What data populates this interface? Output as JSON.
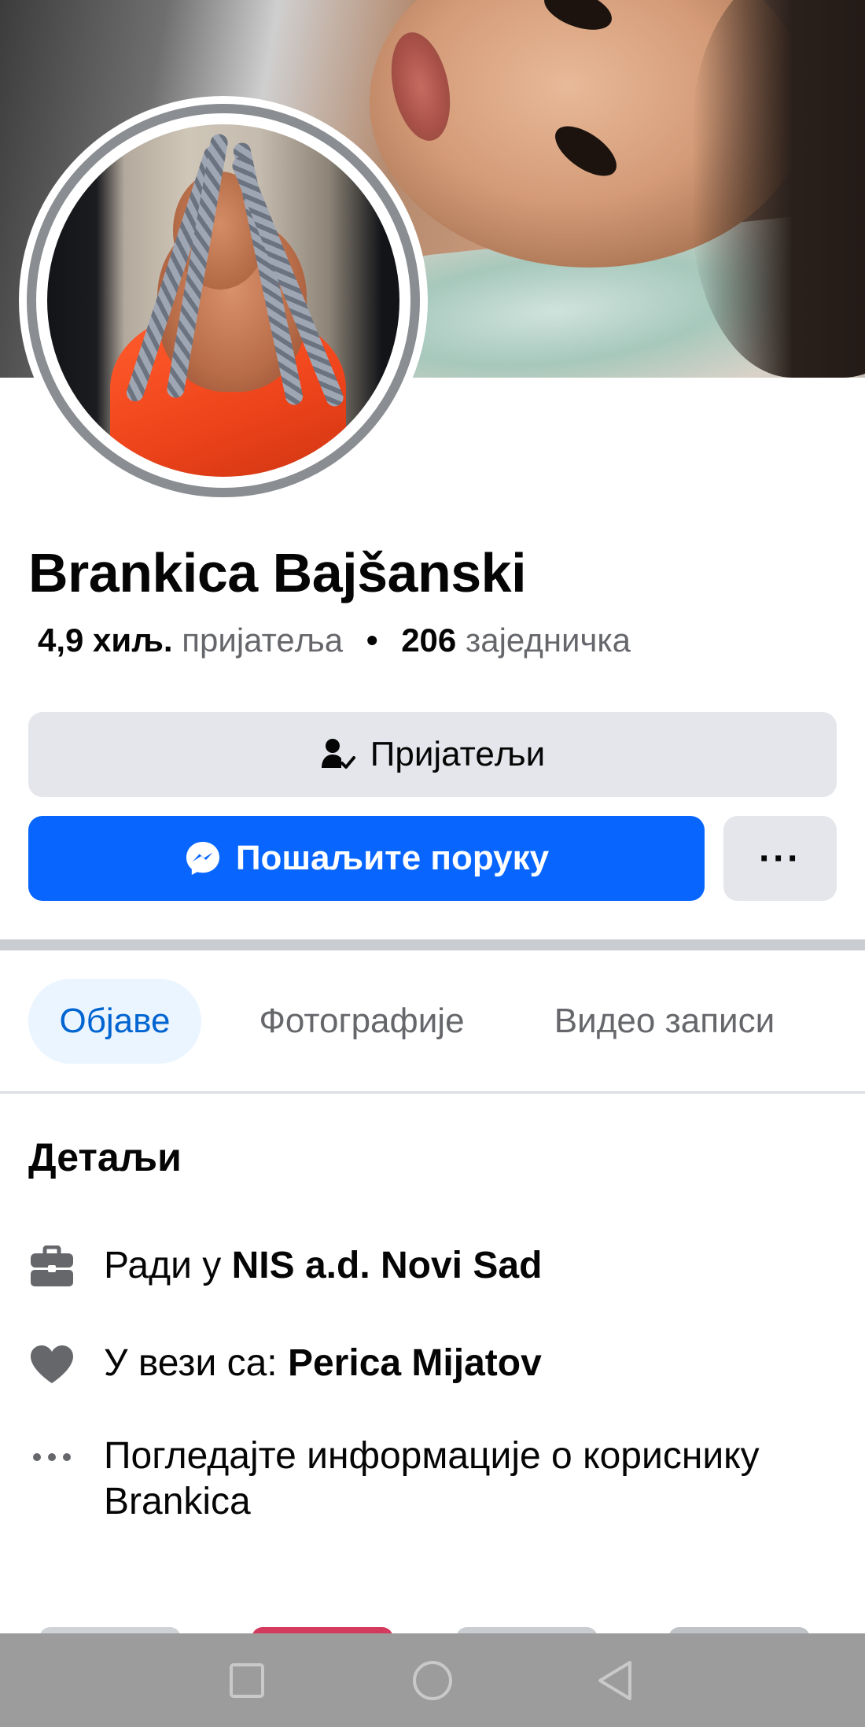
{
  "profile": {
    "name": "Brankica Bajšanski",
    "friends_count": "4,9 хиљ.",
    "friends_label": "пријатеља",
    "separator": "•",
    "mutual_count": "206",
    "mutual_label": "заједничка"
  },
  "actions": {
    "friends_label": "Пријатељи",
    "message_label": "Пошаљите поруку",
    "more_label": "···"
  },
  "tabs": [
    {
      "label": "Објаве",
      "active": true
    },
    {
      "label": "Фотографије",
      "active": false
    },
    {
      "label": "Видео записи",
      "active": false
    }
  ],
  "details": {
    "title": "Детаљи",
    "work_prefix": "Ради у",
    "work_place": "NIS a.d. Novi Sad",
    "relationship_prefix": "У вези са:",
    "relationship_partner": "Perica Mijatov",
    "info_text": "Погледајте информације о кориснику Brankica"
  },
  "icons": {
    "friends": "person-check-icon",
    "message": "messenger-icon",
    "more": "more-dots-icon",
    "work": "briefcase-icon",
    "relationship": "heart-icon",
    "info": "more-dots-icon",
    "nav_recent": "square-icon",
    "nav_home": "circle-icon",
    "nav_back": "triangle-back-icon"
  },
  "colors": {
    "accent": "#0866ff",
    "tab_active_bg": "#ebf5ff",
    "tab_active_text": "#0064d1",
    "button_bg": "#e4e6eb",
    "secondary_text": "#65676b"
  }
}
